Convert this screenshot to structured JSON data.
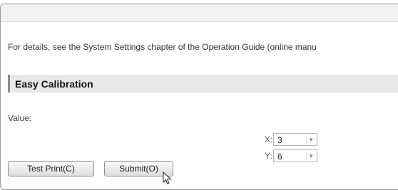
{
  "details_text": "For details, see the System Settings chapter of the Operation Guide (online manu",
  "section": {
    "title": "Easy Calibration"
  },
  "value_label": "Value:",
  "x_field": {
    "label": "X:",
    "value": "3"
  },
  "y_field": {
    "label": "Y:",
    "value": "6"
  },
  "buttons": {
    "test_print": "Test Print(C)",
    "submit": "Submit(O)"
  },
  "icons": {
    "dropdown": "chevron-down-icon",
    "cursor": "mouse-pointer-icon"
  }
}
